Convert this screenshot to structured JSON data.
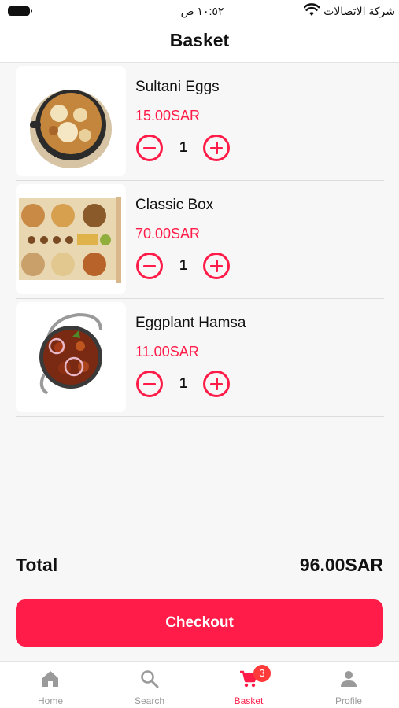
{
  "status_bar": {
    "time": "١٠:٥٢ ص",
    "carrier": "شركة الاتصالات"
  },
  "header": {
    "title": "Basket"
  },
  "items": [
    {
      "name": "Sultani Eggs",
      "price": "15.00SAR",
      "quantity": "1"
    },
    {
      "name": "Classic Box",
      "price": "70.00SAR",
      "quantity": "1"
    },
    {
      "name": "Eggplant Hamsa",
      "price": "11.00SAR",
      "quantity": "1"
    }
  ],
  "summary": {
    "total_label": "Total",
    "total_value": "96.00SAR"
  },
  "checkout": {
    "label": "Checkout"
  },
  "tab_bar": {
    "tabs": [
      {
        "label": "Home",
        "icon": "home-icon"
      },
      {
        "label": "Search",
        "icon": "search-icon"
      },
      {
        "label": "Basket",
        "icon": "cart-icon",
        "badge": "3",
        "active": true
      },
      {
        "label": "Profile",
        "icon": "person-icon"
      }
    ]
  },
  "colors": {
    "accent": "#ff1c48",
    "badge": "#ff3a3a",
    "inactive": "#9a9a9a",
    "background": "#f7f7f7"
  }
}
